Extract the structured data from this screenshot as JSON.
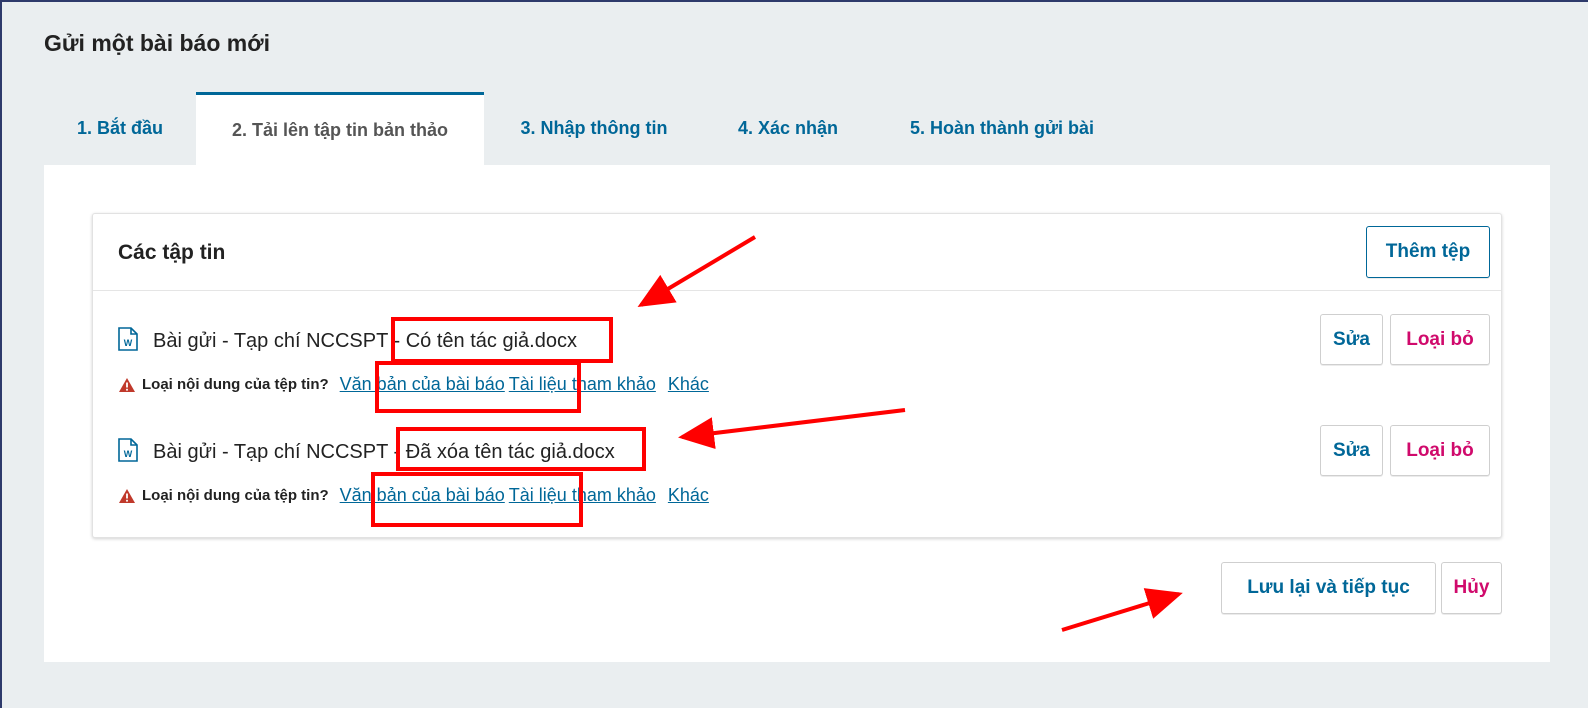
{
  "page": {
    "title": "Gửi một bài báo mới"
  },
  "tabs": [
    {
      "label": "1. Bắt đầu"
    },
    {
      "label": "2. Tải lên tập tin bản thảo"
    },
    {
      "label": "3. Nhập thông tin"
    },
    {
      "label": "4. Xác nhận"
    },
    {
      "label": "5. Hoàn thành gửi bài"
    }
  ],
  "active_tab": "2. Tải lên tập tin bản thảo",
  "files_panel": {
    "title": "Các tập tin",
    "add_button": "Thêm tệp",
    "files": [
      {
        "name_prefix": "Bài gửi - Tạp chí NCCSPT",
        "name_suffix": "- Có tên tác giả.docx",
        "type_question": "Loại nội dung của tệp tin?",
        "type_options": [
          "Văn bản của bài báo",
          "Tài liệu tham khảo",
          "Khác"
        ],
        "edit_label": "Sửa",
        "remove_label": "Loại bỏ",
        "icon": "word-document-icon"
      },
      {
        "name_prefix": "Bài gửi - Tạp chí NCCSPT",
        "name_suffix": "- Đã xóa tên tác giả.docx",
        "type_question": "Loại nội dung của tệp tin?",
        "type_options": [
          "Văn bản của bài báo",
          "Tài liệu tham khảo",
          "Khác"
        ],
        "edit_label": "Sửa",
        "remove_label": "Loại bỏ",
        "icon": "word-document-icon"
      }
    ]
  },
  "actions": {
    "save_continue": "Lưu lại và tiếp tục",
    "cancel": "Hủy"
  },
  "colors": {
    "link": "#006798",
    "danger": "#d00a6c",
    "warning": "#c0392b",
    "annotation": "#ff0000",
    "background": "#eaeef0"
  }
}
